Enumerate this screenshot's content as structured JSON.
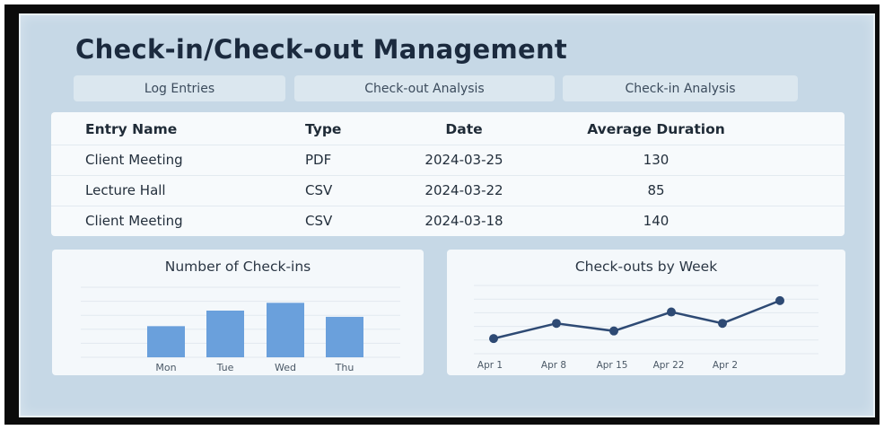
{
  "page": {
    "title": "Check-in/Check-out Management"
  },
  "tabs": [
    {
      "label": "Log Entries"
    },
    {
      "label": "Check-out Analysis"
    },
    {
      "label": "Check-in Analysis"
    }
  ],
  "table": {
    "headers": [
      "Entry Name",
      "Type",
      "Date",
      "Average Duration"
    ],
    "rows": [
      [
        "Client Meeting",
        "PDF",
        "2024-03-25",
        "130"
      ],
      [
        "Lecture Hall",
        "CSV",
        "2024-03-22",
        "85"
      ],
      [
        "Client Meeting",
        "CSV",
        "2024-03-18",
        "140"
      ]
    ]
  },
  "colors": {
    "bar": "#6aa0dc",
    "line": "#2e4a74",
    "grid": "#e2e9ef"
  },
  "chart_data": [
    {
      "type": "bar",
      "title": "Number of Check-ins",
      "categories": [
        "Mon",
        "Tue",
        "Wed",
        "Thu"
      ],
      "values": [
        4,
        6,
        7,
        5.2
      ],
      "ylim": [
        0,
        9
      ],
      "grid": true,
      "xlabel": "",
      "ylabel": ""
    },
    {
      "type": "line",
      "title": "Check-outs by Week",
      "categories": [
        "Apr 1",
        "Apr 8",
        "Apr 15",
        "Apr 22",
        "Apr 2"
      ],
      "points_x": [
        "Apr 1",
        "Apr 8",
        "Apr 15",
        "Apr 22",
        "Apr 2",
        ""
      ],
      "values": [
        2,
        4,
        3,
        5.5,
        4,
        7
      ],
      "ylim": [
        0,
        9
      ],
      "grid": true,
      "xlabel": "",
      "ylabel": ""
    }
  ]
}
